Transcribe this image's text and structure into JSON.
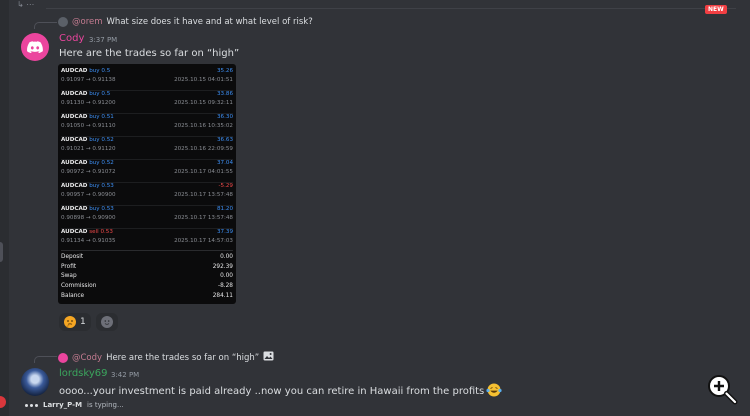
{
  "top_fragment": "↳ ⋯",
  "new_badge": "NEW",
  "reply1": {
    "author": "@orem",
    "text": "What size does it have and at what level of risk?"
  },
  "msg1": {
    "author": "Cody",
    "time": "3:37 PM",
    "text": "Here are the trades so far on “high”"
  },
  "trades": [
    {
      "symbol": "AUDCAD",
      "side": "buy",
      "size": "0.5",
      "profit": "35.26",
      "prices": "0.91097 → 0.91138",
      "time": "2025.10.15 04:01:51",
      "profit_color": "pos"
    },
    {
      "symbol": "AUDCAD",
      "side": "buy",
      "size": "0.5",
      "profit": "33.86",
      "prices": "0.91130 → 0.91200",
      "time": "2025.10.15 09:32:11",
      "profit_color": "pos"
    },
    {
      "symbol": "AUDCAD",
      "side": "buy",
      "size": "0.51",
      "profit": "36.30",
      "prices": "0.91050 → 0.91110",
      "time": "2025.10.16 10:35:02",
      "profit_color": "pos"
    },
    {
      "symbol": "AUDCAD",
      "side": "buy",
      "size": "0.52",
      "profit": "36.63",
      "prices": "0.91021 → 0.91120",
      "time": "2025.10.16 22:09:59",
      "profit_color": "pos"
    },
    {
      "symbol": "AUDCAD",
      "side": "buy",
      "size": "0.52",
      "profit": "37.04",
      "prices": "0.90972 → 0.91072",
      "time": "2025.10.17 04:01:55",
      "profit_color": "pos"
    },
    {
      "symbol": "AUDCAD",
      "side": "buy",
      "size": "0.53",
      "profit": "-5.29",
      "prices": "0.90957 → 0.90900",
      "time": "2025.10.17 13:57:48",
      "profit_color": "neg"
    },
    {
      "symbol": "AUDCAD",
      "side": "buy",
      "size": "0.53",
      "profit": "81.20",
      "prices": "0.90898 → 0.90900",
      "time": "2025.10.17 13:57:48",
      "profit_color": "pos"
    },
    {
      "symbol": "AUDCAD",
      "side": "sell",
      "size": "0.53",
      "profit": "37.39",
      "prices": "0.91134 → 0.91035",
      "time": "2025.10.17 14:57:03",
      "profit_color": "pos"
    }
  ],
  "summary": [
    {
      "label": "Deposit",
      "value": "0.00"
    },
    {
      "label": "Profit",
      "value": "292.39"
    },
    {
      "label": "Swap",
      "value": "0.00"
    },
    {
      "label": "Commission",
      "value": "-8.28"
    },
    {
      "label": "Balance",
      "value": "284.11"
    }
  ],
  "reaction": {
    "count": "1"
  },
  "reply2": {
    "author": "@Cody",
    "text": "Here are the trades so far on “high”"
  },
  "msg2": {
    "author": "lordsky69",
    "time": "3:42 PM",
    "text": "oooo...your investment is paid already ..now  you can retire in Hawaii from the profits"
  },
  "typing": {
    "user": "Larry_P-M",
    "suffix": "is typing..."
  },
  "colors": {
    "cody": "#eb459e",
    "lordsky": "#3ba55d",
    "accent_blue": "#3d8ff4",
    "accent_red": "#f04a4a"
  }
}
